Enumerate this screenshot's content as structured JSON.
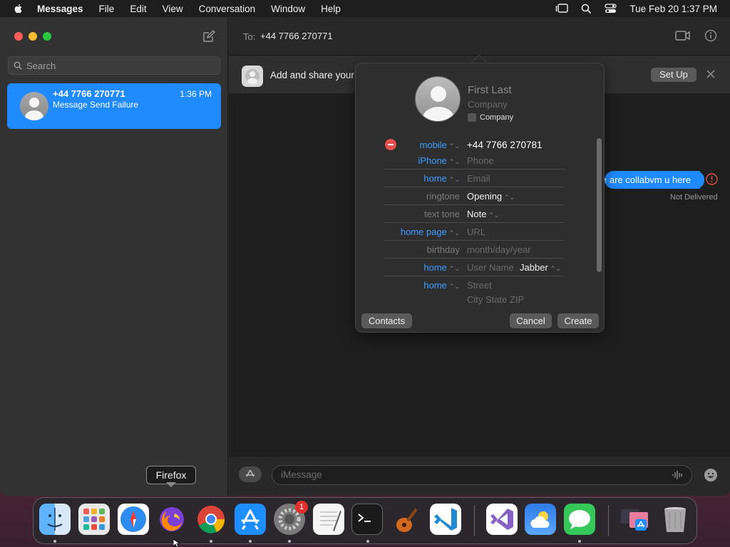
{
  "menubar": {
    "app_name": "Messages",
    "items": [
      "File",
      "Edit",
      "View",
      "Conversation",
      "Window",
      "Help"
    ],
    "clock": "Tue Feb 20  1:37 PM"
  },
  "sidebar": {
    "search_placeholder": "Search",
    "conversations": [
      {
        "name": "+44 7766 270771",
        "preview": "Message Send Failure",
        "time": "1:36 PM",
        "selected": true
      }
    ]
  },
  "header": {
    "to_label": "To:",
    "to_value": "+44 7766 270771"
  },
  "banner": {
    "text": "Add and share your",
    "setup_label": "Set Up"
  },
  "messages": [
    {
      "text": "e are collabvm u here",
      "status": "Not Delivered",
      "direction": "outgoing"
    }
  ],
  "composer": {
    "placeholder": "iMessage"
  },
  "contact_card": {
    "name_placeholder": "First  Last",
    "company_placeholder": "Company",
    "company_checkbox_label": "Company",
    "fields": [
      {
        "label": "mobile",
        "value": "+44 7766 270781",
        "label_style": "blue",
        "value_style": "strong"
      },
      {
        "label": "iPhone",
        "value": "Phone",
        "label_style": "blue",
        "value_style": "placeholder"
      },
      {
        "label": "home",
        "value": "Email",
        "label_style": "blue",
        "value_style": "placeholder"
      },
      {
        "label": "ringtone",
        "value": "Opening",
        "label_style": "gray",
        "value_style": "value"
      },
      {
        "label": "text tone",
        "value": "Note",
        "label_style": "gray",
        "value_style": "value"
      },
      {
        "label": "home page",
        "value": "URL",
        "label_style": "blue",
        "value_style": "placeholder"
      },
      {
        "label": "birthday",
        "value": "month/day/year",
        "label_style": "gray",
        "value_style": "placeholder"
      },
      {
        "label": "home",
        "value": "User Name",
        "extra": "Jabber",
        "label_style": "blue",
        "value_style": "placeholder"
      },
      {
        "label": "home",
        "value": "Street",
        "value2": "City  State  ZIP",
        "label_style": "blue",
        "value_style": "placeholder"
      }
    ],
    "buttons": {
      "contacts": "Contacts",
      "cancel": "Cancel",
      "create": "Create"
    }
  },
  "tooltip": "Firefox",
  "dock": {
    "items": [
      "Finder",
      "Launchpad",
      "Safari",
      "Firefox",
      "Chrome",
      "App Store",
      "System Settings",
      "TextEdit",
      "Terminal",
      "GarageBand",
      "Visual Studio Code",
      "Visual Studio",
      "Weather",
      "Messages",
      "Downloads",
      "Trash"
    ],
    "settings_badge": "1"
  },
  "colors": {
    "accent": "#1f8bff",
    "label_blue": "#3d9bff",
    "danger": "#e3504b"
  }
}
